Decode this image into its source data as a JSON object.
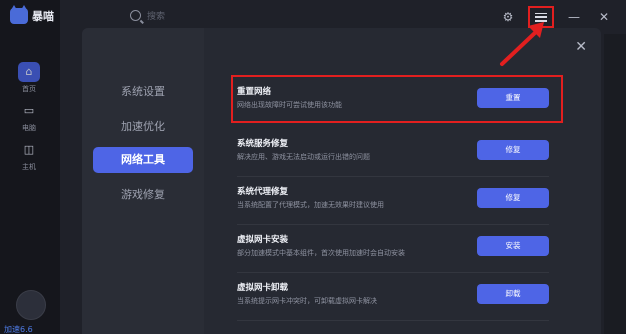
{
  "app": {
    "name": "暴喵"
  },
  "rail": {
    "items": [
      {
        "label": "首页",
        "icon": "home-icon"
      },
      {
        "label": "电脑",
        "icon": "monitor-icon"
      },
      {
        "label": "主机",
        "icon": "gamepad-icon"
      }
    ],
    "bottom_text": "加速6.6"
  },
  "search": {
    "placeholder": "搜索"
  },
  "dialog": {
    "side_items": [
      "系统设置",
      "加速优化",
      "网络工具",
      "游戏修复"
    ],
    "active_index": 2,
    "rows": [
      {
        "title": "重置网络",
        "desc": "网络出现故障时可尝试使用该功能",
        "button": "重置"
      },
      {
        "title": "系统服务修复",
        "desc": "解决应用、游戏无法启动或运行出错的问题",
        "button": "修复"
      },
      {
        "title": "系统代理修复",
        "desc": "当系统配置了代理模式，加速无效果时建议使用",
        "button": "修复"
      },
      {
        "title": "虚拟网卡安装",
        "desc": "部分加速模式中基本组件，首次使用加速时会自动安装",
        "button": "安装"
      },
      {
        "title": "虚拟网卡卸载",
        "desc": "当系统提示网卡冲突时，可卸载虚拟网卡解决",
        "button": "卸载"
      }
    ]
  },
  "colors": {
    "accent": "#4e65e6",
    "highlight": "#e21f1f"
  }
}
